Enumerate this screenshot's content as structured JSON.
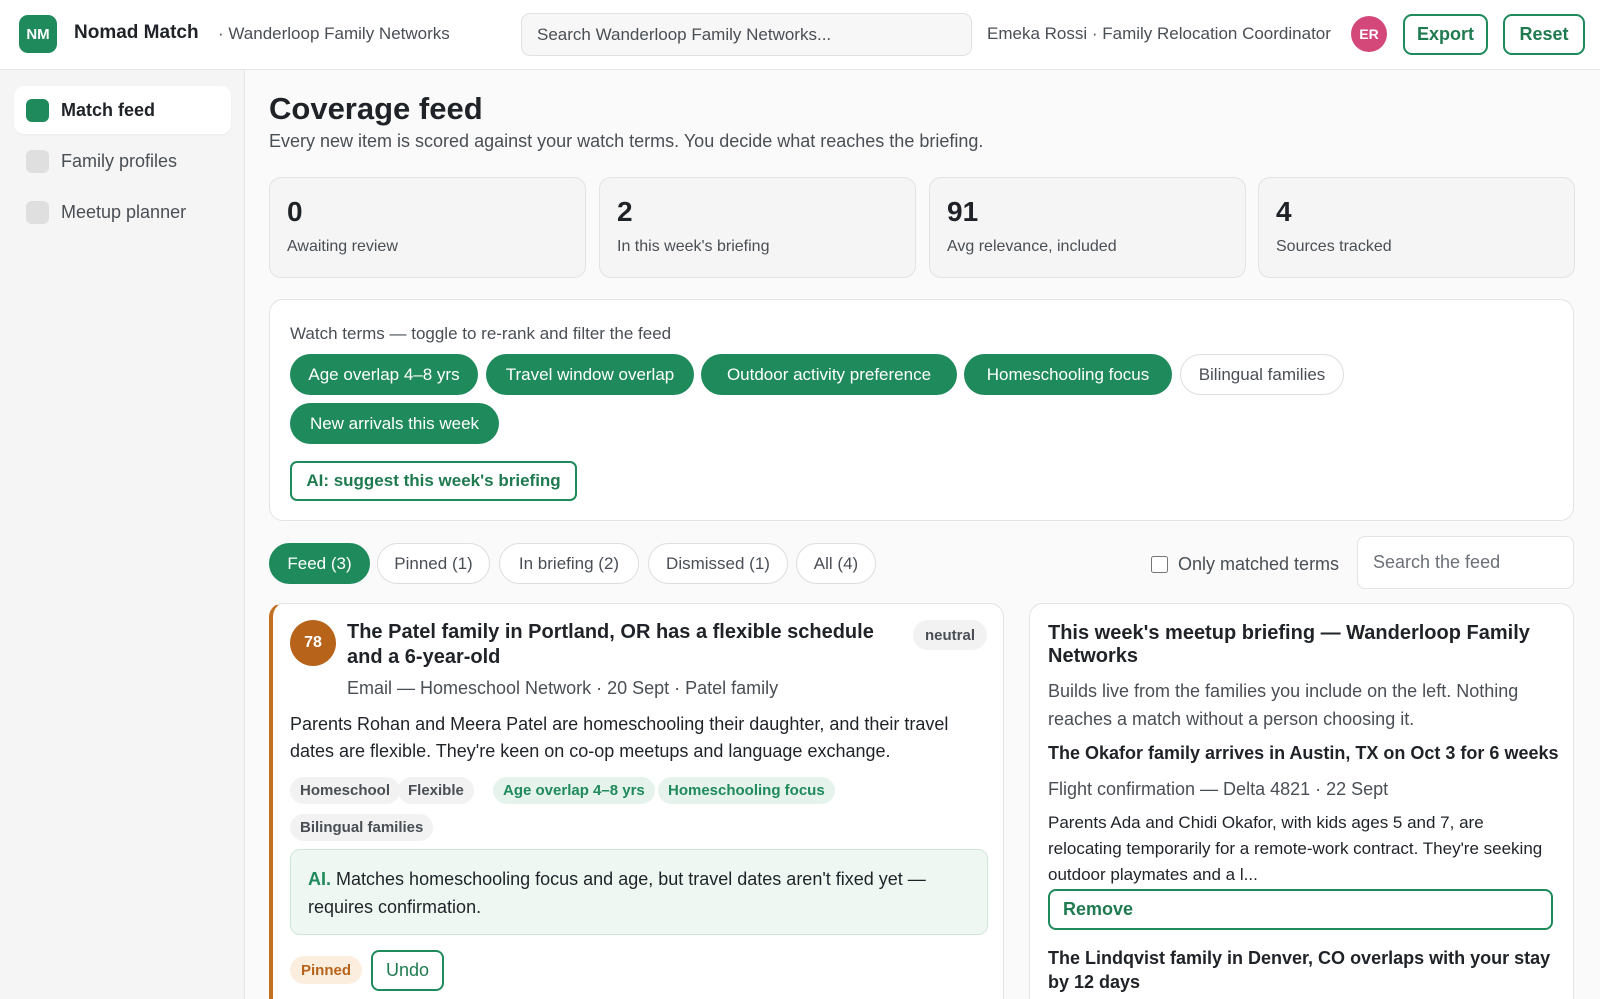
{
  "header": {
    "logo": "NM",
    "app_name": "Nomad Match",
    "workspace": "· Wanderloop Family Networks",
    "search_placeholder": "Search Wanderloop Family Networks...",
    "user": "Emeka Rossi · Family Relocation Coordinator",
    "avatar": "ER",
    "export_label": "Export",
    "reset_label": "Reset"
  },
  "sidebar": {
    "items": [
      {
        "label": "Match feed",
        "active": true
      },
      {
        "label": "Family profiles",
        "active": false
      },
      {
        "label": "Meetup planner",
        "active": false
      }
    ]
  },
  "main": {
    "title": "Coverage feed",
    "subtitle": "Every new item is scored against your watch terms. You decide what reaches the briefing.",
    "stats": [
      {
        "value": "0",
        "label": "Awaiting review"
      },
      {
        "value": "2",
        "label": "In this week's briefing"
      },
      {
        "value": "91",
        "label": "Avg relevance, included"
      },
      {
        "value": "4",
        "label": "Sources tracked"
      }
    ],
    "watch": {
      "title": "Watch terms — toggle to re-rank and filter the feed",
      "terms": [
        {
          "label": "Age overlap 4–8 yrs",
          "on": true
        },
        {
          "label": "Travel window overlap",
          "on": true
        },
        {
          "label": "Outdoor activity preference",
          "on": true
        },
        {
          "label": "Homeschooling focus",
          "on": true
        },
        {
          "label": "Bilingual families",
          "on": false
        },
        {
          "label": "New arrivals this week",
          "on": true
        }
      ],
      "ai_button": "AI: suggest this week's briefing"
    },
    "tabs": [
      {
        "label": "Feed (3)",
        "active": true
      },
      {
        "label": "Pinned (1)",
        "active": false
      },
      {
        "label": "In briefing (2)",
        "active": false
      },
      {
        "label": "Dismissed (1)",
        "active": false
      },
      {
        "label": "All (4)",
        "active": false
      }
    ],
    "only_matched_label": "Only matched terms",
    "only_matched_checked": false,
    "feed_search_placeholder": "Search the feed",
    "feed_item": {
      "score": "78",
      "title": "The Patel family in Portland, OR has a flexible schedule and a 6-year-old",
      "sentiment": "neutral",
      "meta": "Email — Homeschool Network · 20 Sept · Patel family",
      "body": "Parents Rohan and Meera Patel are homeschooling their daughter, and their travel dates are flexible. They're keen on co-op meetups and language exchange.",
      "tags": [
        {
          "label": "Homeschool",
          "matched": false
        },
        {
          "label": "Flexible",
          "matched": false
        },
        {
          "label": "Age overlap 4–8 yrs",
          "matched": true
        },
        {
          "label": "Homeschooling focus",
          "matched": true
        },
        {
          "label": "Bilingual families",
          "matched": false
        }
      ],
      "ai_label": "AI.",
      "ai_text": "Matches homeschooling focus and age, but travel dates aren't fixed yet — requires confirmation.",
      "status": "Pinned",
      "undo_label": "Undo"
    },
    "briefing": {
      "title": "This week's meetup briefing — Wanderloop Family Networks",
      "description": "Builds live from the families you include on the left. Nothing reaches a match without a person choosing it.",
      "items": [
        {
          "title": "The Okafor family arrives in Austin, TX on Oct 3 for 6 weeks",
          "meta": "Flight confirmation — Delta 4821 · 22 Sept",
          "body": "Parents Ada and Chidi Okafor, with kids ages 5 and 7, are relocating temporarily for a remote-work contract. They're seeking outdoor playmates and a l...",
          "action": "Remove"
        },
        {
          "title": "The Lindqvist family in Denver, CO overlaps with your stay by 12 days"
        }
      ]
    }
  },
  "colors": {
    "accent": "#1f8a5b",
    "score": "#b8631a",
    "avatar": "#d34879"
  }
}
